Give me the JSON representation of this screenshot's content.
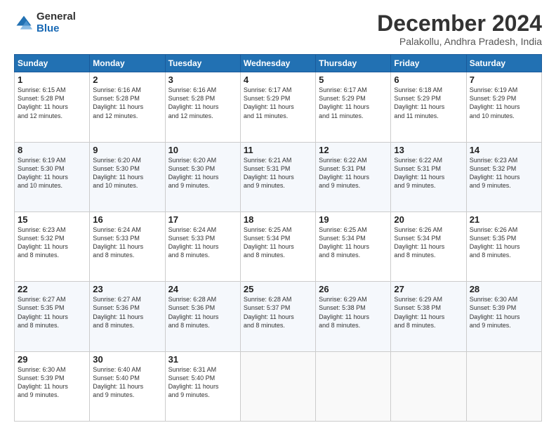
{
  "logo": {
    "general": "General",
    "blue": "Blue"
  },
  "title": "December 2024",
  "location": "Palakollu, Andhra Pradesh, India",
  "days_of_week": [
    "Sunday",
    "Monday",
    "Tuesday",
    "Wednesday",
    "Thursday",
    "Friday",
    "Saturday"
  ],
  "weeks": [
    [
      {
        "day": "1",
        "info": "Sunrise: 6:15 AM\nSunset: 5:28 PM\nDaylight: 11 hours\nand 12 minutes."
      },
      {
        "day": "2",
        "info": "Sunrise: 6:16 AM\nSunset: 5:28 PM\nDaylight: 11 hours\nand 12 minutes."
      },
      {
        "day": "3",
        "info": "Sunrise: 6:16 AM\nSunset: 5:28 PM\nDaylight: 11 hours\nand 12 minutes."
      },
      {
        "day": "4",
        "info": "Sunrise: 6:17 AM\nSunset: 5:29 PM\nDaylight: 11 hours\nand 11 minutes."
      },
      {
        "day": "5",
        "info": "Sunrise: 6:17 AM\nSunset: 5:29 PM\nDaylight: 11 hours\nand 11 minutes."
      },
      {
        "day": "6",
        "info": "Sunrise: 6:18 AM\nSunset: 5:29 PM\nDaylight: 11 hours\nand 11 minutes."
      },
      {
        "day": "7",
        "info": "Sunrise: 6:19 AM\nSunset: 5:29 PM\nDaylight: 11 hours\nand 10 minutes."
      }
    ],
    [
      {
        "day": "8",
        "info": "Sunrise: 6:19 AM\nSunset: 5:30 PM\nDaylight: 11 hours\nand 10 minutes."
      },
      {
        "day": "9",
        "info": "Sunrise: 6:20 AM\nSunset: 5:30 PM\nDaylight: 11 hours\nand 10 minutes."
      },
      {
        "day": "10",
        "info": "Sunrise: 6:20 AM\nSunset: 5:30 PM\nDaylight: 11 hours\nand 9 minutes."
      },
      {
        "day": "11",
        "info": "Sunrise: 6:21 AM\nSunset: 5:31 PM\nDaylight: 11 hours\nand 9 minutes."
      },
      {
        "day": "12",
        "info": "Sunrise: 6:22 AM\nSunset: 5:31 PM\nDaylight: 11 hours\nand 9 minutes."
      },
      {
        "day": "13",
        "info": "Sunrise: 6:22 AM\nSunset: 5:31 PM\nDaylight: 11 hours\nand 9 minutes."
      },
      {
        "day": "14",
        "info": "Sunrise: 6:23 AM\nSunset: 5:32 PM\nDaylight: 11 hours\nand 9 minutes."
      }
    ],
    [
      {
        "day": "15",
        "info": "Sunrise: 6:23 AM\nSunset: 5:32 PM\nDaylight: 11 hours\nand 8 minutes."
      },
      {
        "day": "16",
        "info": "Sunrise: 6:24 AM\nSunset: 5:33 PM\nDaylight: 11 hours\nand 8 minutes."
      },
      {
        "day": "17",
        "info": "Sunrise: 6:24 AM\nSunset: 5:33 PM\nDaylight: 11 hours\nand 8 minutes."
      },
      {
        "day": "18",
        "info": "Sunrise: 6:25 AM\nSunset: 5:34 PM\nDaylight: 11 hours\nand 8 minutes."
      },
      {
        "day": "19",
        "info": "Sunrise: 6:25 AM\nSunset: 5:34 PM\nDaylight: 11 hours\nand 8 minutes."
      },
      {
        "day": "20",
        "info": "Sunrise: 6:26 AM\nSunset: 5:34 PM\nDaylight: 11 hours\nand 8 minutes."
      },
      {
        "day": "21",
        "info": "Sunrise: 6:26 AM\nSunset: 5:35 PM\nDaylight: 11 hours\nand 8 minutes."
      }
    ],
    [
      {
        "day": "22",
        "info": "Sunrise: 6:27 AM\nSunset: 5:35 PM\nDaylight: 11 hours\nand 8 minutes."
      },
      {
        "day": "23",
        "info": "Sunrise: 6:27 AM\nSunset: 5:36 PM\nDaylight: 11 hours\nand 8 minutes."
      },
      {
        "day": "24",
        "info": "Sunrise: 6:28 AM\nSunset: 5:36 PM\nDaylight: 11 hours\nand 8 minutes."
      },
      {
        "day": "25",
        "info": "Sunrise: 6:28 AM\nSunset: 5:37 PM\nDaylight: 11 hours\nand 8 minutes."
      },
      {
        "day": "26",
        "info": "Sunrise: 6:29 AM\nSunset: 5:38 PM\nDaylight: 11 hours\nand 8 minutes."
      },
      {
        "day": "27",
        "info": "Sunrise: 6:29 AM\nSunset: 5:38 PM\nDaylight: 11 hours\nand 8 minutes."
      },
      {
        "day": "28",
        "info": "Sunrise: 6:30 AM\nSunset: 5:39 PM\nDaylight: 11 hours\nand 9 minutes."
      }
    ],
    [
      {
        "day": "29",
        "info": "Sunrise: 6:30 AM\nSunset: 5:39 PM\nDaylight: 11 hours\nand 9 minutes."
      },
      {
        "day": "30",
        "info": "Sunrise: 6:40 AM\nSunset: 5:40 PM\nDaylight: 11 hours\nand 9 minutes."
      },
      {
        "day": "31",
        "info": "Sunrise: 6:31 AM\nSunset: 5:40 PM\nDaylight: 11 hours\nand 9 minutes."
      },
      {
        "day": "",
        "info": ""
      },
      {
        "day": "",
        "info": ""
      },
      {
        "day": "",
        "info": ""
      },
      {
        "day": "",
        "info": ""
      }
    ]
  ]
}
